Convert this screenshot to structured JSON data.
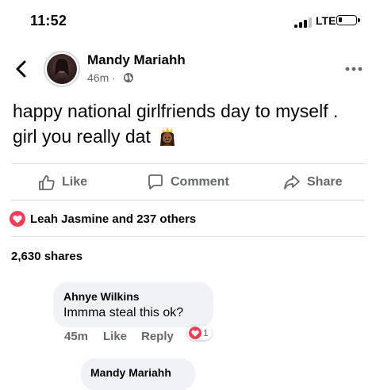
{
  "status_bar": {
    "time": "11:52",
    "network": "LTE",
    "battery_icon": "battery-low-icon",
    "signal_icon": "signal-bars-icon"
  },
  "post": {
    "author": "Mandy Mariahh",
    "time_ago": "46m",
    "privacy_icon": "globe-icon",
    "text": "happy national girlfriends day to myself . girl you really dat",
    "emoji_icon": "princess-emoji-icon"
  },
  "actions": {
    "like": "Like",
    "comment": "Comment",
    "share": "Share"
  },
  "reactions": {
    "summary": "Leah Jasmine and 237 others",
    "icon": "heart-reaction-icon"
  },
  "shares": "2,630 shares",
  "comments": [
    {
      "name": "Ahnye Wilkins",
      "text": "Immma steal this ok?",
      "time": "45m",
      "like": "Like",
      "reply": "Reply",
      "reaction_count": "1"
    },
    {
      "name": "Mandy Mariahh"
    }
  ],
  "colors": {
    "reaction_red": "#f33e58",
    "secondary_text": "#65676b",
    "bubble_bg": "#f0f2f5"
  }
}
